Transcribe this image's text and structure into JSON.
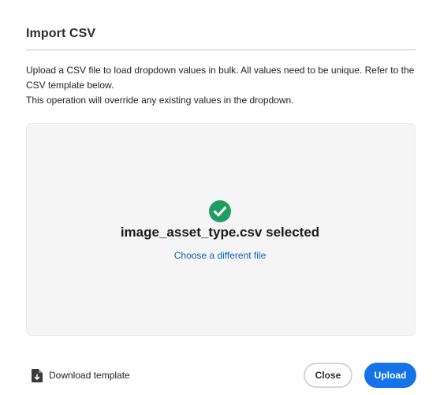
{
  "dialog": {
    "title": "Import CSV",
    "description": [
      "Upload a CSV file to load dropdown values in bulk. All values need to be unique. Refer to the CSV template below.",
      "This operation will override any existing values in the dropdown."
    ]
  },
  "dropzone": {
    "status_icon": "check-circle-icon",
    "selected_text": "image_asset_type.csv selected",
    "choose_link": "Choose a different file"
  },
  "footer": {
    "download_icon": "document-download-icon",
    "download_label": "Download template",
    "close_label": "Close",
    "upload_label": "Upload"
  },
  "colors": {
    "accent": "#1473e6",
    "link": "#0d5ec4",
    "success": "#1e9e63",
    "dropzone_bg": "#f5f5f5"
  }
}
